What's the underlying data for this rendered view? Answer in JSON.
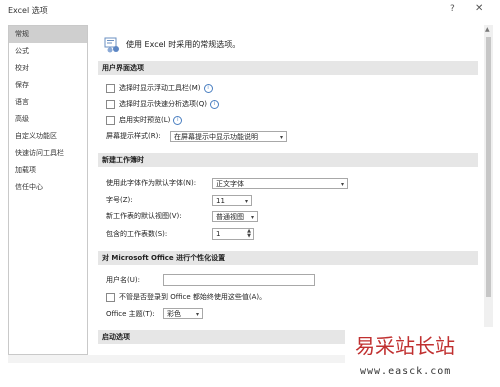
{
  "window": {
    "title": "Excel 选项",
    "help": "?",
    "close": "✕"
  },
  "nav": {
    "items": [
      "常规",
      "公式",
      "校对",
      "保存",
      "语言",
      "高级",
      "自定义功能区",
      "快速访问工具栏",
      "加载项",
      "信任中心"
    ],
    "active_index": 0
  },
  "intro": {
    "text": "使用 Excel 时采用的常规选项。",
    "icon": "general-options-icon"
  },
  "ui_section": {
    "header": "用户界面选项",
    "checkbox_mini_toolbar": "选择时显示浮动工具栏(M)",
    "checkbox_quick_analysis": "选择时显示快速分析选项(Q)",
    "checkbox_live_preview": "启用实时预览(L)",
    "screentip_label": "屏幕提示样式(R):",
    "screentip_value": "在屏幕提示中显示功能说明"
  },
  "new_workbook": {
    "header": "新建工作簿时",
    "font_label": "使用此字体作为默认字体(N):",
    "font_value": "正文字体",
    "size_label": "字号(Z):",
    "size_value": "11",
    "view_label": "新工作表的默认视图(V):",
    "view_value": "普通视图",
    "sheets_label": "包含的工作表数(S):",
    "sheets_value": "1"
  },
  "personalize": {
    "header": "对 Microsoft Office 进行个性化设置",
    "username_label": "用户名(U):",
    "username_value": "",
    "always_use_label": "不管是否登录到 Office 都始终使用这些值(A)。",
    "theme_label": "Office 主题(T):",
    "theme_value": "彩色"
  },
  "startup": {
    "header": "启动选项"
  },
  "watermark": {
    "title": "易采站长站",
    "url": "www.easck.com"
  }
}
